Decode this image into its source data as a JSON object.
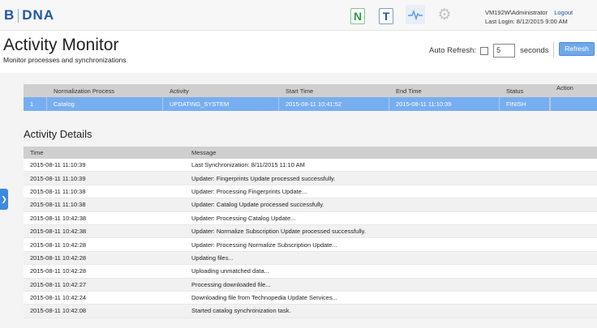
{
  "brand": {
    "logo_left": "B",
    "logo_right": "DNA"
  },
  "nav": {
    "n_label": "N",
    "t_label": "T"
  },
  "user": {
    "name": "VM192W\\Administrator",
    "logout": "Logout",
    "last_login": "Last Login: 8/12/2015 9:00 AM"
  },
  "page": {
    "title": "Activity Monitor",
    "subtitle": "Monitor processes and synchronizations"
  },
  "autorefresh": {
    "label": "Auto Refresh:",
    "checked": false,
    "value": "5",
    "unit": "seconds",
    "refresh_label": "Refresh"
  },
  "process_table": {
    "headers": [
      "",
      "Normalization Process",
      "Activity",
      "Start Time",
      "End Time",
      "Status",
      "Action"
    ],
    "rows": [
      {
        "index": "1",
        "process": "Catalog",
        "activity": "UPDATING_SYSTEM",
        "start": "2015-08-11 10:41:52",
        "end": "2015-08-11 11:10:39",
        "status": "FINISH",
        "action": ""
      }
    ]
  },
  "details": {
    "title": "Activity Details",
    "headers": {
      "time": "Time",
      "message": "Message"
    },
    "rows": [
      {
        "time": "2015-08-11 11:10:39",
        "message": "Last Synchronization: 8/11/2015 11:10 AM"
      },
      {
        "time": "2015-08-11 11:10:39",
        "message": "Updater: Fingerprints Update processed successfully."
      },
      {
        "time": "2015-08-11 11:10:38",
        "message": "Updater: Processing Fingerprints Update..."
      },
      {
        "time": "2015-08-11 11:10:38",
        "message": "Updater: Catalog Update processed successfully."
      },
      {
        "time": "2015-08-11 10:42:38",
        "message": "Updater: Processing Catalog Update..."
      },
      {
        "time": "2015-08-11 10:42:38",
        "message": "Updater: Normalize Subscription Update processed successfully."
      },
      {
        "time": "2015-08-11 10:42:28",
        "message": "Updater: Processing Normalize Subscription Update..."
      },
      {
        "time": "2015-08-11 10:42:28",
        "message": "Updating files..."
      },
      {
        "time": "2015-08-11 10:42:28",
        "message": "Uploading unmatched data..."
      },
      {
        "time": "2015-08-11 10:42:27",
        "message": "Processing downloaded file..."
      },
      {
        "time": "2015-08-11 10:42:24",
        "message": "Downloading file from Technopedia Update Services..."
      },
      {
        "time": "2015-08-11 10:42:08",
        "message": "Started catalog synchronization task."
      }
    ]
  },
  "colors": {
    "brand_blue": "#1f57a8",
    "selected_row": "#77aef0",
    "refresh_button": "#6fa8ea"
  }
}
